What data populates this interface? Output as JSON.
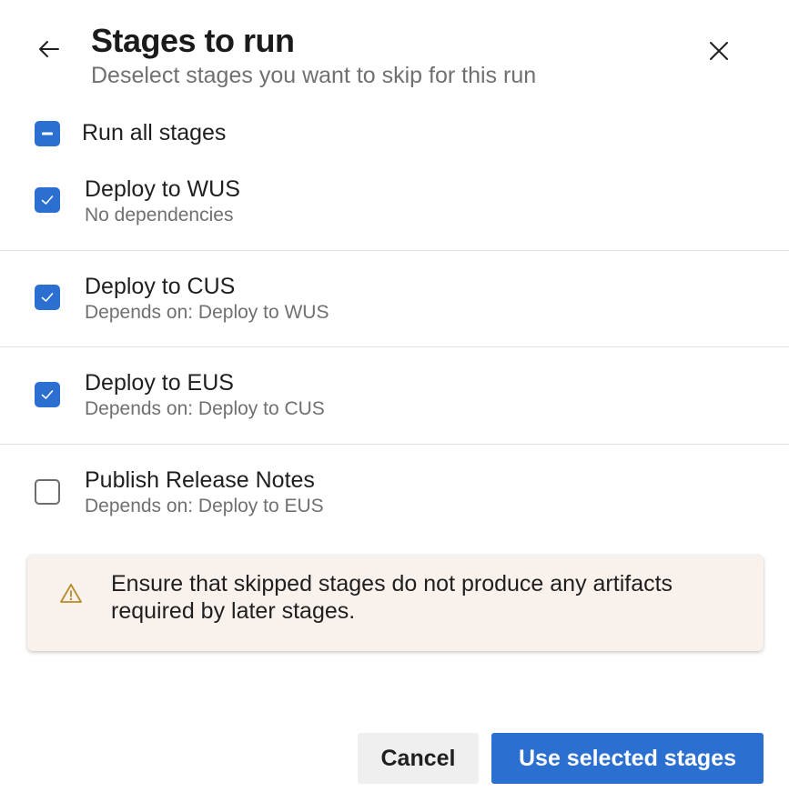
{
  "header": {
    "title": "Stages to run",
    "subtitle": "Deselect stages you want to skip for this run",
    "back_icon": "arrow-left-icon",
    "close_icon": "close-icon"
  },
  "run_all": {
    "label": "Run all stages",
    "state": "indeterminate"
  },
  "stages": [
    {
      "name": "Deploy to WUS",
      "dependency": "No dependencies",
      "checked": true
    },
    {
      "name": "Deploy to CUS",
      "dependency": "Depends on: Deploy to WUS",
      "checked": true
    },
    {
      "name": "Deploy to EUS",
      "dependency": "Depends on: Deploy to CUS",
      "checked": true
    },
    {
      "name": "Publish Release Notes",
      "dependency": "Depends on: Deploy to EUS",
      "checked": false
    }
  ],
  "warning": {
    "icon": "warning-icon",
    "text": "Ensure that skipped stages do not produce any artifacts required by later stages."
  },
  "footer": {
    "cancel_label": "Cancel",
    "submit_label": "Use selected stages"
  },
  "colors": {
    "accent": "#2b6fd0",
    "warning_bg": "#f9f1eb",
    "warning_icon": "#b98a2a"
  }
}
